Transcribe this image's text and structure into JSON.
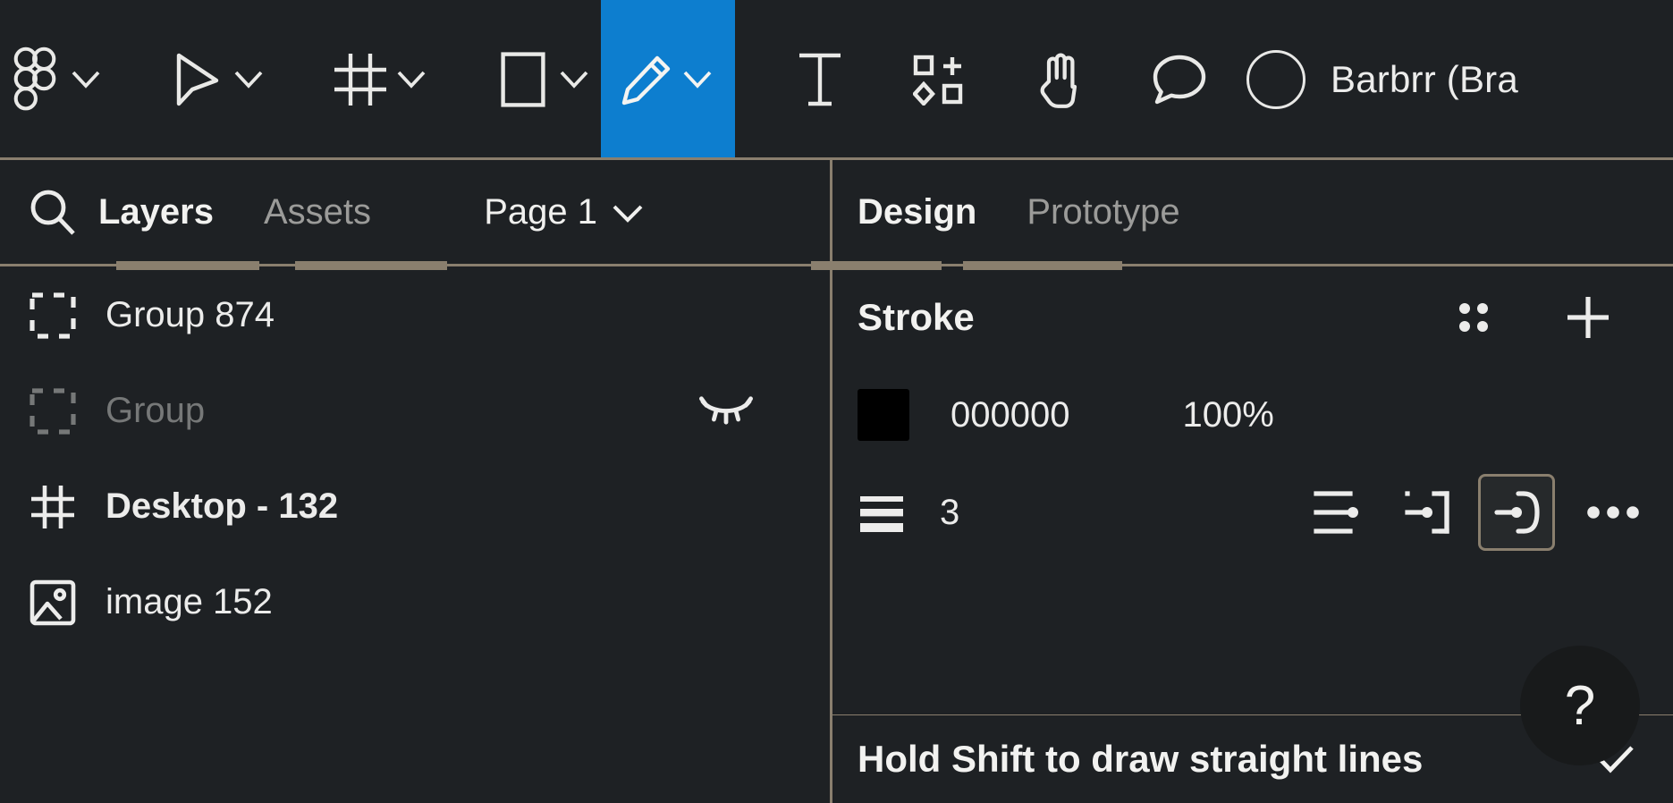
{
  "colors": {
    "background": "#1e2124",
    "accent_active_tool": "#0d7ecf",
    "divider": "#8a7f6e",
    "text_primary": "#f2f2f0",
    "text_dim": "#9b9b99",
    "stroke_swatch": "#000000"
  },
  "toolbar": {
    "items": [
      {
        "icon": "figma-logo-icon",
        "label": "Figma menu",
        "has_chevron": true,
        "active": false
      },
      {
        "icon": "cursor-move-icon",
        "label": "Move",
        "has_chevron": true,
        "active": false
      },
      {
        "icon": "frame-icon",
        "label": "Frame",
        "has_chevron": true,
        "active": false
      },
      {
        "icon": "rectangle-icon",
        "label": "Shape",
        "has_chevron": true,
        "active": false
      },
      {
        "icon": "pencil-icon",
        "label": "Pencil",
        "has_chevron": true,
        "active": true
      },
      {
        "icon": "text-icon",
        "label": "Text",
        "has_chevron": false,
        "active": false
      },
      {
        "icon": "component-add-icon",
        "label": "Actions / Resources",
        "has_chevron": false,
        "active": false
      },
      {
        "icon": "hand-icon",
        "label": "Hand",
        "has_chevron": false,
        "active": false
      },
      {
        "icon": "comment-icon",
        "label": "Comment",
        "has_chevron": false,
        "active": false
      }
    ],
    "user_name": "Barbrr (Bra"
  },
  "left_panel": {
    "search_icon": "search-icon",
    "tabs": [
      {
        "label": "Layers",
        "active": true
      },
      {
        "label": "Assets",
        "active": false
      }
    ],
    "page_selector": {
      "label": "Page 1",
      "chevron": "chevron-down-icon"
    },
    "layers": [
      {
        "icon": "group-icon",
        "label": "Group 874",
        "dim": false,
        "bold": false,
        "hidden": false
      },
      {
        "icon": "group-icon",
        "label": "Group",
        "dim": true,
        "bold": false,
        "hidden": true
      },
      {
        "icon": "frame-icon",
        "label": "Desktop - 132",
        "dim": false,
        "bold": true,
        "hidden": false
      },
      {
        "icon": "image-icon",
        "label": "image 152",
        "dim": false,
        "bold": false,
        "hidden": false
      }
    ],
    "hidden_badge_icon": "eye-closed-icon"
  },
  "right_panel": {
    "tabs": [
      {
        "label": "Design",
        "active": true
      },
      {
        "label": "Prototype",
        "active": false
      }
    ],
    "stroke": {
      "title": "Stroke",
      "styles_icon": "grid-dots-icon",
      "add_icon": "plus-icon",
      "color_hex": "000000",
      "opacity": "100%",
      "weight_icon": "stroke-weight-icon",
      "weight": "3",
      "align_options": [
        {
          "icon": "stroke-align-center-icon",
          "selected": false
        },
        {
          "icon": "stroke-align-inside-icon",
          "selected": false
        },
        {
          "icon": "stroke-cap-round-icon",
          "selected": true
        }
      ],
      "more_icon": "more-horizontal-icon"
    }
  },
  "help_button": {
    "label": "?"
  },
  "bottom_banner": {
    "text": "Hold Shift to draw straight lines",
    "dismiss_icon": "chevron-down-icon"
  }
}
